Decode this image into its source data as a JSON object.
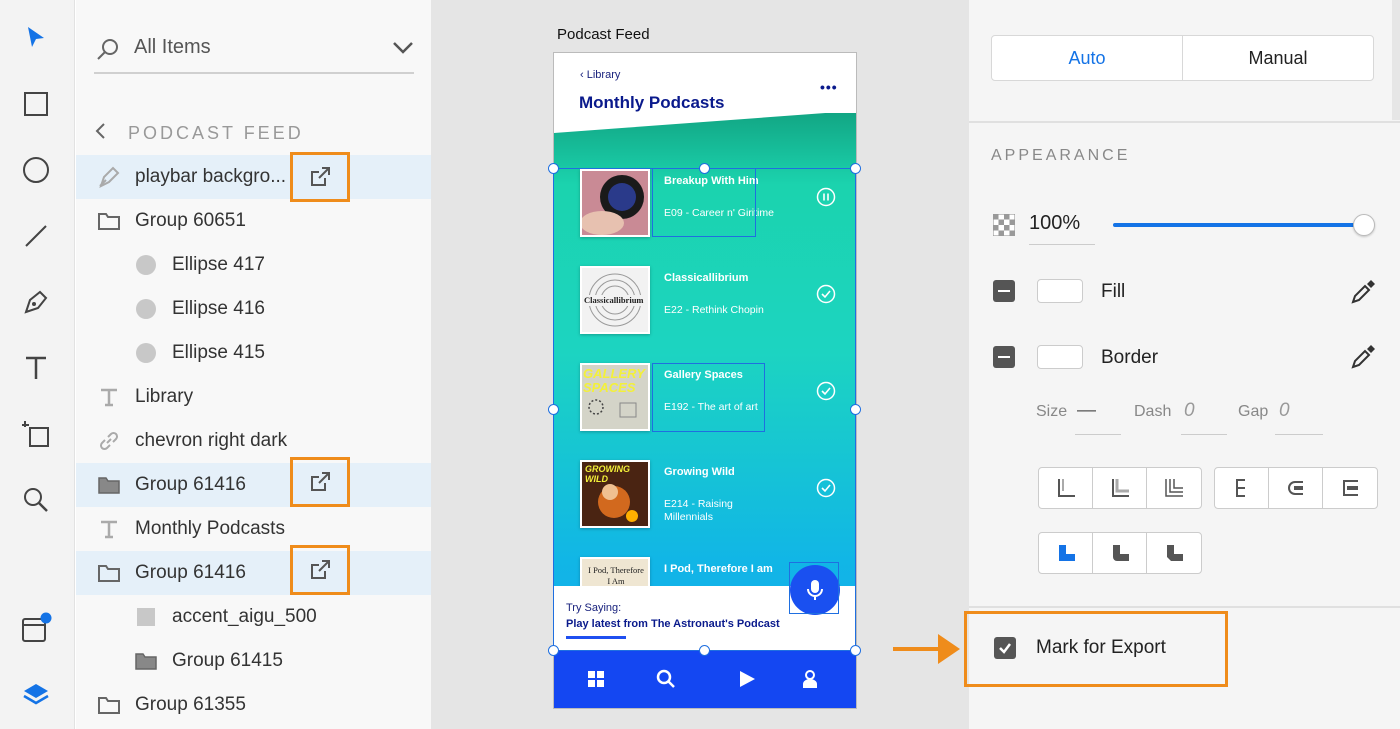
{
  "colors": {
    "accent_blue": "#1473e6",
    "export_highlight": "#ef8c1b",
    "tabbar_blue": "#1447f2"
  },
  "toolbar": {
    "tools": [
      "select-icon",
      "rectangle-icon",
      "ellipse-icon",
      "line-icon",
      "pen-icon",
      "text-icon",
      "artboard-icon",
      "zoom-icon",
      "plugins-icon",
      "layers-icon"
    ]
  },
  "layers": {
    "search_placeholder": "All Items",
    "breadcrumb": "PODCAST FEED",
    "items": [
      {
        "label": "playbar backgro...",
        "icon": "pen-path-icon",
        "selected": true,
        "export": true
      },
      {
        "label": "Group 60651",
        "icon": "folder-icon"
      },
      {
        "label": "Ellipse 417",
        "icon": "ellipse-icon"
      },
      {
        "label": "Ellipse 416",
        "icon": "ellipse-icon"
      },
      {
        "label": "Ellipse 415",
        "icon": "ellipse-icon"
      },
      {
        "label": "Library",
        "icon": "text-icon"
      },
      {
        "label": "chevron right dark",
        "icon": "link-icon"
      },
      {
        "label": "Group 61416",
        "icon": "folder-icon",
        "selected": true,
        "export": true
      },
      {
        "label": "Monthly Podcasts",
        "icon": "text-icon"
      },
      {
        "label": "Group 61416",
        "icon": "folder-icon",
        "selected": true,
        "export": true
      },
      {
        "label": "accent_aigu_500",
        "icon": "square-icon"
      },
      {
        "label": "Group 61415",
        "icon": "folder-icon"
      },
      {
        "label": "Group 61355",
        "icon": "folder-icon"
      }
    ]
  },
  "canvas": {
    "artboard_label": "Podcast Feed",
    "back_label": "Library",
    "title": "Monthly Podcasts",
    "episodes": [
      {
        "title": "Breakup With Him",
        "subtitle": "E09 - Career n' Giritime",
        "status": "pause-icon"
      },
      {
        "title": "Classicallibrium",
        "subtitle": "E22 - Rethink Chopin",
        "status": "check-icon",
        "art_text": "Classicallibrium"
      },
      {
        "title": "Gallery Spaces",
        "subtitle": "E192 - The art of art",
        "status": "check-icon",
        "art_text": "GALLERY SPACES"
      },
      {
        "title": "Growing Wild",
        "subtitle": "E214 - Raising Millennials",
        "status": "check-icon",
        "art_text": "GROWING WILD"
      },
      {
        "title": "I Pod, Therefore I am",
        "subtitle": "",
        "status": "",
        "art_text": "I Pod, Therefore I Am"
      }
    ],
    "voice": {
      "prompt": "Try Saying:",
      "command": "Play latest from The Astronaut's Podcast"
    }
  },
  "inspector": {
    "responsive": {
      "auto": "Auto",
      "manual": "Manual"
    },
    "appearance_title": "APPEARANCE",
    "opacity": "100%",
    "opacity_level": 1.0,
    "fill_label": "Fill",
    "border_label": "Border",
    "size_label": "Size",
    "size_value": "—",
    "dash_label": "Dash",
    "dash_value": "0",
    "gap_label": "Gap",
    "gap_value": "0",
    "export_label": "Mark for Export",
    "export_checked": true
  }
}
